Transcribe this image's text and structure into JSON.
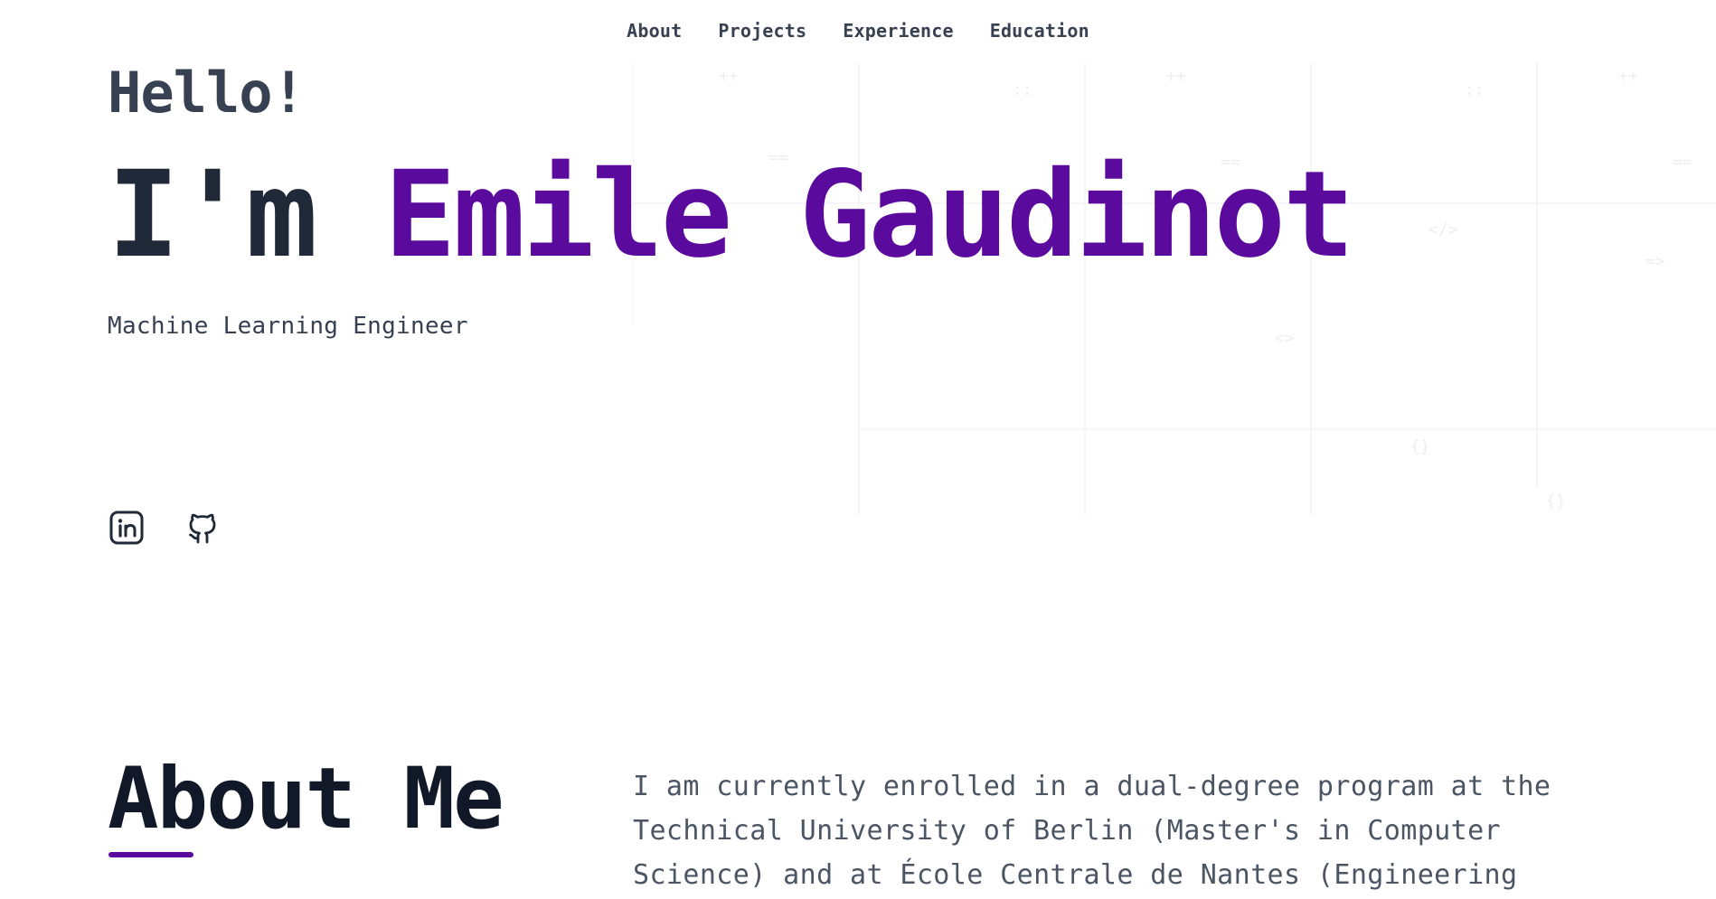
{
  "nav": {
    "items": [
      "About",
      "Projects",
      "Experience",
      "Education"
    ]
  },
  "hero": {
    "greeting": "Hello!",
    "intro_prefix": "I'm ",
    "name": "Emile Gaudinot",
    "role": "Machine Learning Engineer"
  },
  "socials": [
    {
      "icon": "linkedin-icon"
    },
    {
      "icon": "github-icon"
    }
  ],
  "about": {
    "title": "About Me",
    "text": "I am currently enrolled in a dual-degree program at the Technical University of Berlin (Master's in Computer Science) and at École Centrale de Nantes (Engineering"
  },
  "colors": {
    "accent": "#5b0a9e",
    "heading": "#1f2937",
    "body": "#4b5563"
  }
}
